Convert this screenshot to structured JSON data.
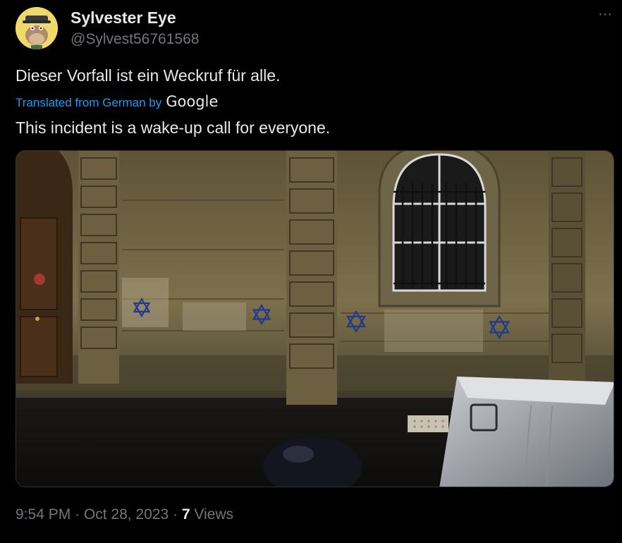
{
  "author": {
    "name": "Sylvester Eye",
    "handle": "@Sylvest56761568",
    "avatar_icon": "ape-avatar-icon"
  },
  "more_icon_glyph": "···",
  "tweet": {
    "text": "Dieser Vorfall ist ein Weckruf für alle.",
    "translation_prefix": "Translated from German by",
    "translation_provider": "Google",
    "translated_text": "This incident is a wake-up call for everyone."
  },
  "media": {
    "kind": "photo",
    "description_icon": "photo-wall-stars-of-david-icon"
  },
  "meta": {
    "time": "9:54 PM",
    "separator": "·",
    "date": "Oct 28, 2023",
    "views_count": "7",
    "views_label": "Views"
  },
  "colors": {
    "background": "#000000",
    "text_primary": "#e7e9ea",
    "text_secondary": "#71767b",
    "link": "#1d9bf0"
  }
}
